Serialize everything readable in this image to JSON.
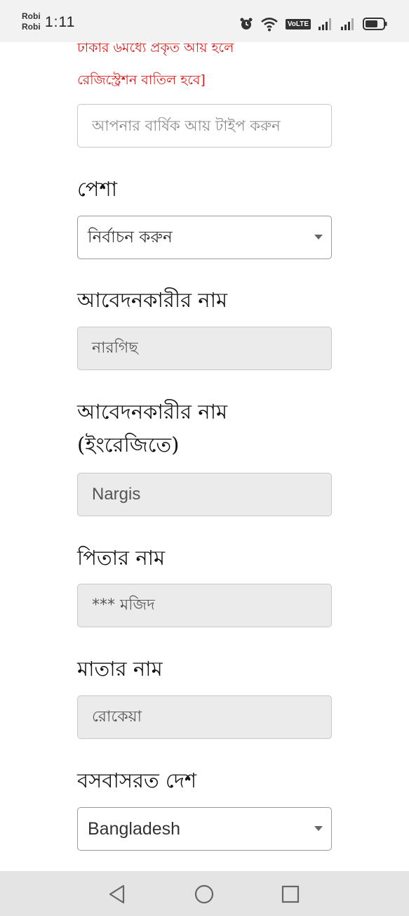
{
  "status_bar": {
    "carrier_1": "Robi",
    "carrier_2": "Robi",
    "time": "1:11",
    "volte": "VoLTE"
  },
  "form": {
    "warning_line_1": "ঢাকার ৬মধ্যে প্রকৃত আয় হলে",
    "warning_line_2": "রেজিস্ট্রেশন বাতিল হবে]",
    "income_placeholder": "আপনার বার্ষিক আয় টাইপ করুন",
    "occupation_label": "পেশা",
    "occupation_value": "নির্বাচন করুন",
    "applicant_name_label": "আবেদনকারীর নাম",
    "applicant_name_value": "নারগিছ",
    "applicant_name_en_label_1": "আবেদনকারীর নাম",
    "applicant_name_en_label_2": "(ইংরেজিতে)",
    "applicant_name_en_value": "Nargis",
    "father_name_label": "পিতার নাম",
    "father_name_value": "*** মজিদ",
    "mother_name_label": "মাতার নাম",
    "mother_name_value": "রোকেয়া",
    "country_label": "বসবাসরত দেশ",
    "country_value": "Bangladesh"
  },
  "colors": {
    "warning": "#e02020",
    "readonly_bg": "#ebebeb",
    "nav_bg": "#e4e4e4"
  },
  "icons": [
    "alarm-icon",
    "wifi-icon",
    "signal-icon",
    "battery-icon",
    "back-icon",
    "home-icon",
    "recents-icon",
    "chevron-down-icon"
  ]
}
